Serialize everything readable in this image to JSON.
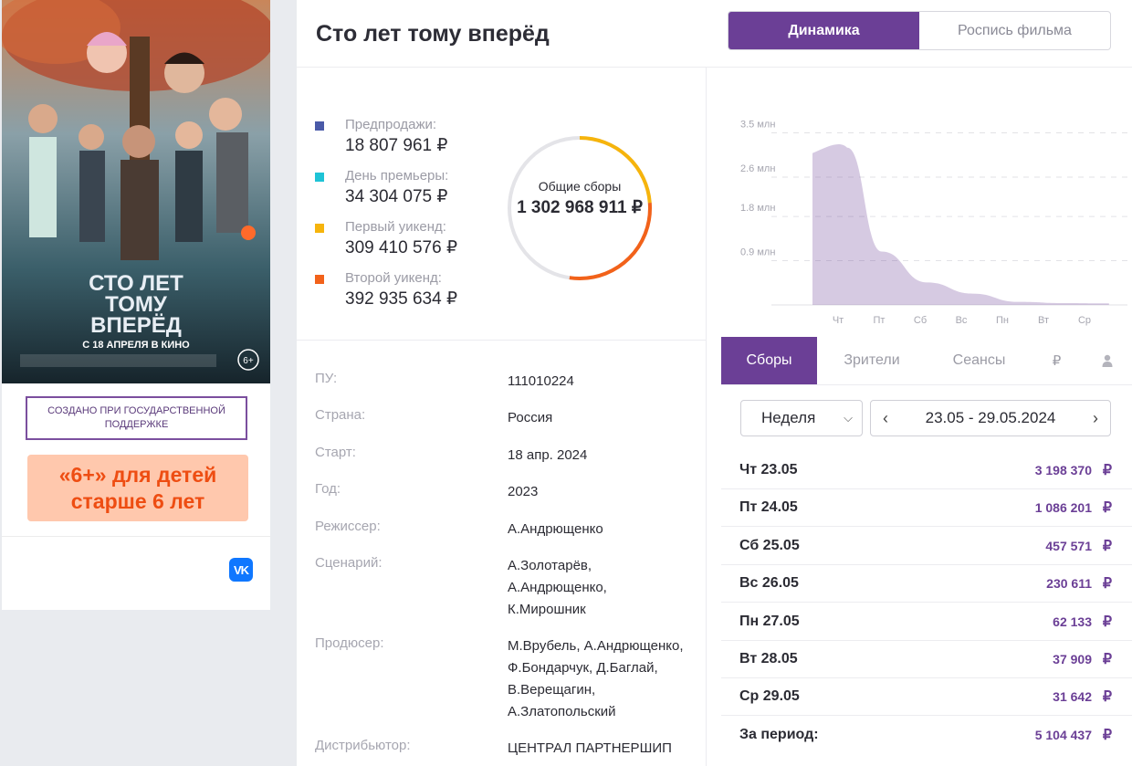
{
  "left": {
    "support_text": "СОЗДАНО ПРИ ГОСУДАРСТВЕННОЙ ПОДДЕРЖКЕ",
    "age_text": "«6+» для детей старше 6 лет",
    "vk_label": "VK",
    "poster": {
      "title_line1": "СТО ЛЕТ",
      "title_line2": "ТОМУ",
      "title_line3": "ВПЕРЁД",
      "release": "С 18 АПРЕЛЯ В КИНО",
      "age": "6+"
    }
  },
  "header": {
    "title": "Сто лет тому вперёд",
    "tab_dynamics": "Динамика",
    "tab_schedule": "Роспись фильма"
  },
  "stats": {
    "items": [
      {
        "label": "Предпродажи:",
        "value": "18 807 961 ₽",
        "color": "#4a5aa8"
      },
      {
        "label": "День премьеры:",
        "value": "34 304 075 ₽",
        "color": "#1ec3d6"
      },
      {
        "label": "Первый уикенд:",
        "value": "309 410 576 ₽",
        "color": "#f6b40c"
      },
      {
        "label": "Второй уикенд:",
        "value": "392 935 634 ₽",
        "color": "#f2621a"
      }
    ],
    "total_label": "Общие сборы",
    "total_value": "1 302 968 911 ₽"
  },
  "info": [
    {
      "key": "ПУ:",
      "value": "111010224"
    },
    {
      "key": "Страна:",
      "value": "Россия"
    },
    {
      "key": "Старт:",
      "value": "18 апр. 2024"
    },
    {
      "key": "Год:",
      "value": "2023"
    },
    {
      "key": "Режиссер:",
      "value": "А.Андрющенко"
    },
    {
      "key": "Сценарий:",
      "value": "А.Золотарёв,\nА.Андрющенко,\nК.Мирошник"
    },
    {
      "key": "Продюсер:",
      "value": "М.Врубель, А.Андрющенко,\nФ.Бондарчук, Д.Баглай,\nВ.Верещагин,\nА.Златопольский"
    },
    {
      "key": "Дистрибьютор:",
      "value": "ЦЕНТРАЛ ПАРТНЕРШИП"
    }
  ],
  "chart_data": {
    "type": "area",
    "y_ticks": [
      "0.9 млн",
      "1.8 млн",
      "2.6 млн",
      "3.5 млн"
    ],
    "categories": [
      "Чт",
      "Пт",
      "Сб",
      "Вс",
      "Пн",
      "Вт",
      "Ср"
    ],
    "values": [
      3198370,
      1086201,
      457571,
      230611,
      62133,
      37909,
      31642
    ],
    "ylim": [
      0,
      3900000
    ],
    "color": "#6b3f96",
    "grid": true
  },
  "tabs": {
    "revenue": "Сборы",
    "viewers": "Зрители",
    "sessions": "Сеансы",
    "ruble_icon": "₽",
    "person_icon": "person-icon"
  },
  "period": {
    "select_value": "Неделя",
    "range": "23.05 - 29.05.2024"
  },
  "days": [
    {
      "day": "Чт 23.05",
      "amount": "3 198 370"
    },
    {
      "day": "Пт 24.05",
      "amount": "1 086 201"
    },
    {
      "day": "Сб 25.05",
      "amount": "457 571"
    },
    {
      "day": "Вс 26.05",
      "amount": "230 611"
    },
    {
      "day": "Пн 27.05",
      "amount": "62 133"
    },
    {
      "day": "Вт 28.05",
      "amount": "37 909"
    },
    {
      "day": "Ср 29.05",
      "amount": "31 642"
    },
    {
      "day": "За период:",
      "amount": "5 104 437"
    }
  ],
  "currency": "₽"
}
